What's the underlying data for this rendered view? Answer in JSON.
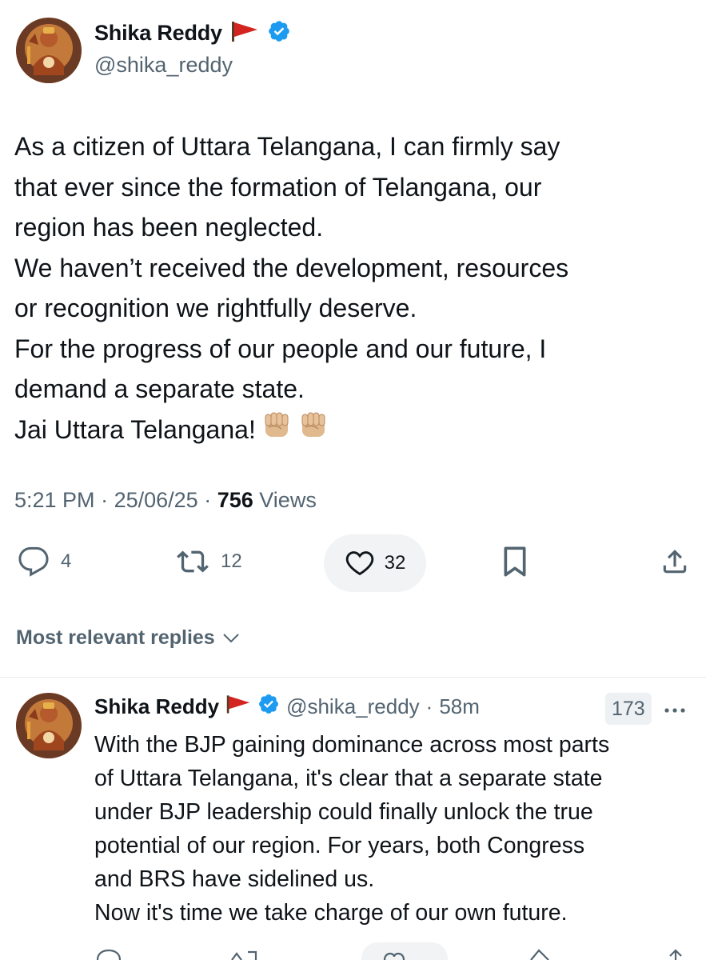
{
  "main_tweet": {
    "author_name": "Shika Reddy",
    "author_handle": "@shika_reddy",
    "text_lines": [
      "As a citizen of Uttara Telangana, I can firmly say",
      "that ever since the formation of Telangana, our",
      "region has been neglected.",
      "We haven’t received the development, resources",
      "or recognition we rightfully deserve.",
      "For the progress of our people and our future, I",
      "demand a separate state.",
      "Jai  Uttara Telangana!"
    ],
    "time": "5:21 PM",
    "date": "25/06/25",
    "views_count": "756",
    "views_label": "Views",
    "reply_count": "4",
    "retweet_count": "12",
    "like_count": "32"
  },
  "replies_sort": {
    "label": "Most relevant replies"
  },
  "reply": {
    "author_name": "Shika Reddy",
    "author_handle": "@shika_reddy",
    "time_ago": "58m",
    "badge": "173",
    "text_lines": [
      "With the BJP gaining dominance across most parts",
      "of Uttara Telangana, it's clear that a separate state",
      "under BJP leadership could finally unlock the true",
      "potential of our region. For years, both Congress",
      "and BRS have sidelined us.",
      "Now  it's time we take charge of our own future."
    ]
  },
  "colors": {
    "text_primary": "#0f1419",
    "text_secondary": "#536471",
    "verified_blue": "#1d9bf0",
    "flag_red": "#d4241f",
    "pill_bg": "#f1f3f4"
  },
  "icons": {
    "reply": "speech-bubble-icon",
    "retweet": "retweet-icon",
    "like": "heart-icon",
    "bookmark": "bookmark-icon",
    "share": "share-icon",
    "verified": "verified-badge-icon",
    "flag": "saffron-flag-icon",
    "fist": "raised-fist-emoji",
    "more": "more-dots-icon",
    "chevron": "chevron-down-icon"
  }
}
